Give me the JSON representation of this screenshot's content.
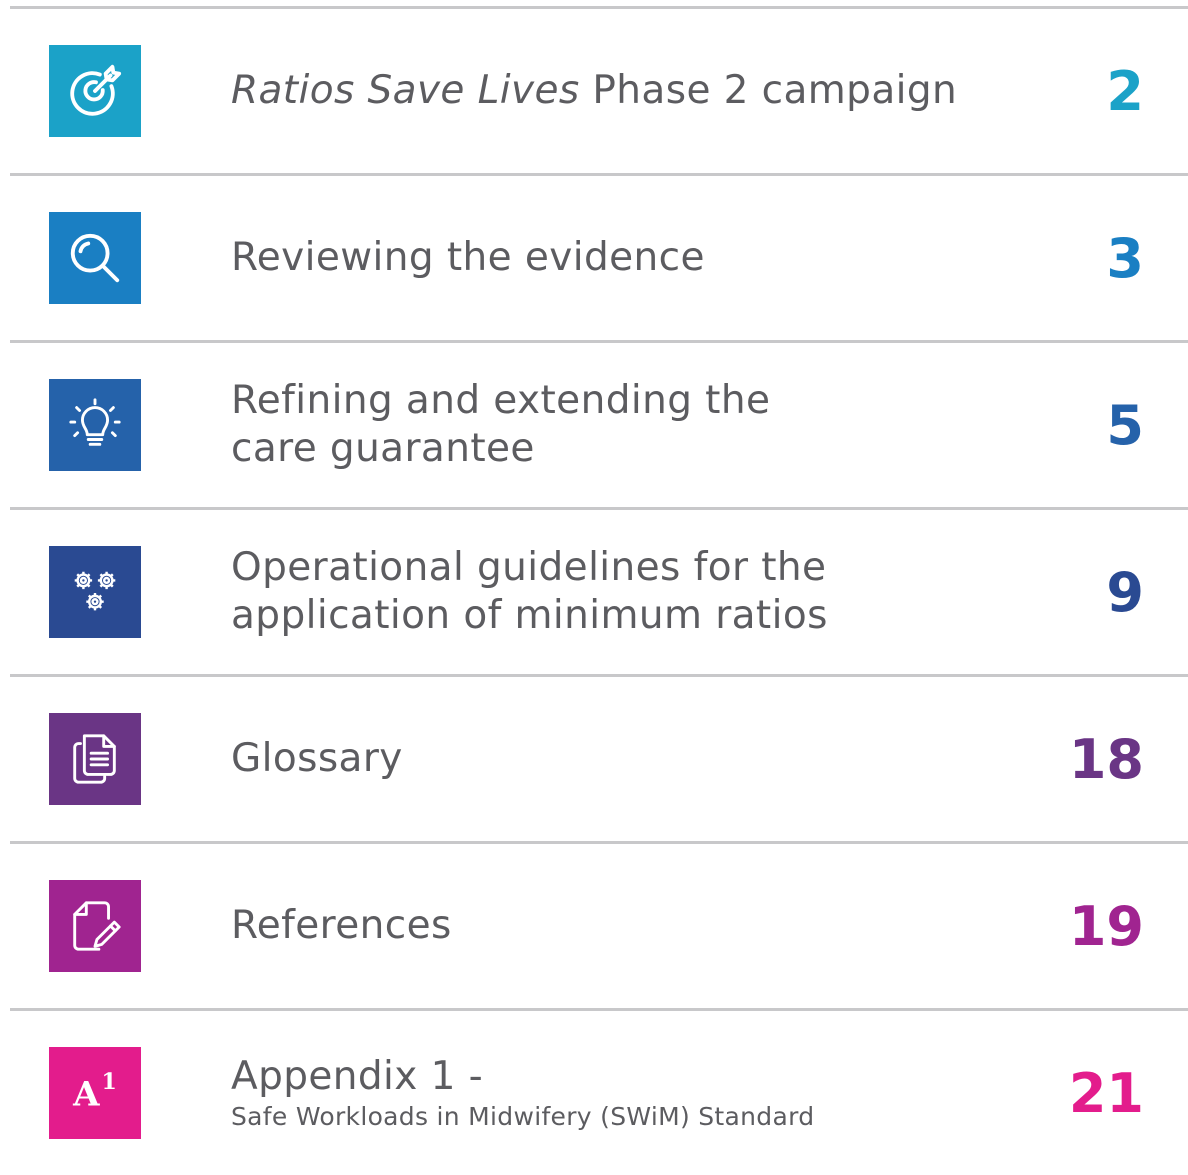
{
  "toc": {
    "entries": [
      {
        "title_italic": "Ratios Save Lives",
        "title_rest": " Phase 2 campaign",
        "page": "2",
        "color": "#1ba2c8",
        "icon": "target-icon"
      },
      {
        "title": "Reviewing the evidence",
        "page": "3",
        "color": "#1a7fc3",
        "icon": "magnifier-icon"
      },
      {
        "title_line1": "Refining and extending the",
        "title_line2": "care guarantee",
        "page": "5",
        "color": "#2562aa",
        "icon": "lightbulb-icon"
      },
      {
        "title_line1": "Operational guidelines for the",
        "title_line2": "application of minimum ratios",
        "page": "9",
        "color": "#2a4a92",
        "icon": "gears-icon"
      },
      {
        "title": "Glossary",
        "page": "18",
        "color": "#6a3585",
        "icon": "documents-icon"
      },
      {
        "title": "References",
        "page": "19",
        "color": "#a02490",
        "icon": "document-pencil-icon"
      },
      {
        "title_line1": "Appendix 1 -",
        "subtitle": "Safe Workloads in Midwifery (SWiM) Standard",
        "page": "21",
        "color": "#e31c8c",
        "icon": "a1-icon",
        "icon_letter": "A",
        "icon_sup": "1"
      }
    ]
  }
}
